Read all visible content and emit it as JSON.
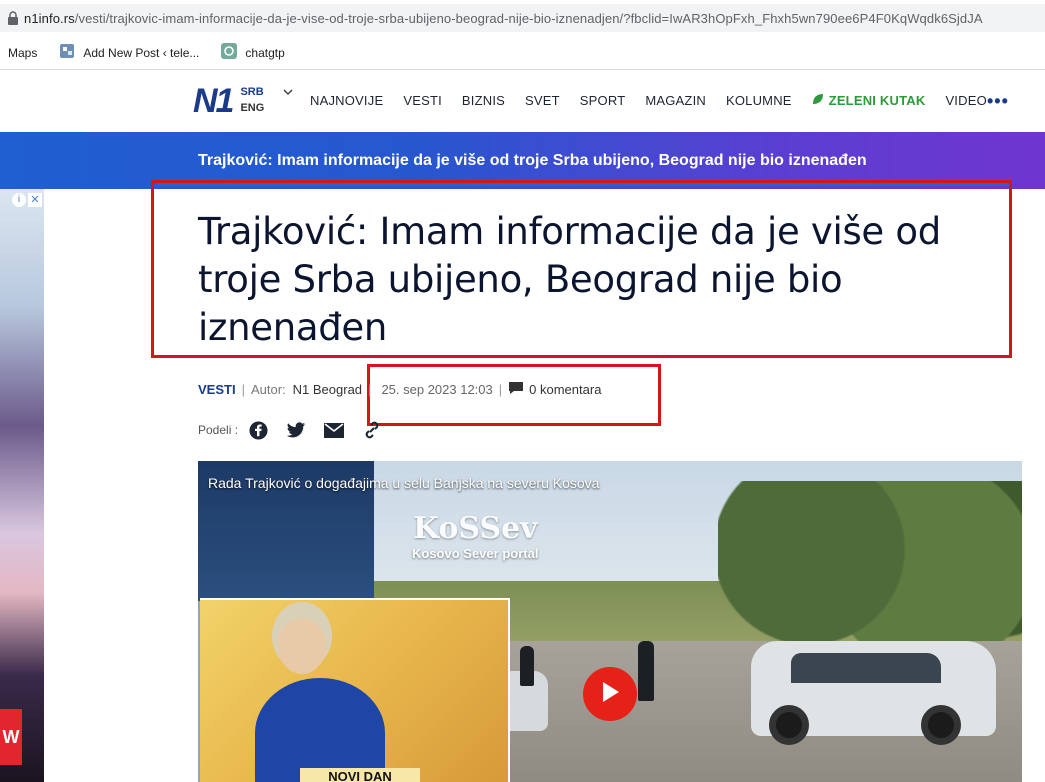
{
  "browser": {
    "url_host": "n1info.rs",
    "url_path": "/vesti/trajkovic-imam-informacije-da-je-vise-od-troje-srba-ubijeno-beograd-nije-bio-iznenadjen/?fbclid=IwAR3hOpFxh_Fhxh5wn790ee6P4F0KqWqdk6SjdJA",
    "bookmarks": [
      {
        "label": "Maps",
        "icon": "maps-icon"
      },
      {
        "label": "Add New Post ‹ tele...",
        "icon": "wordpress-icon"
      },
      {
        "label": "chatgtp",
        "icon": "openai-icon"
      }
    ]
  },
  "site": {
    "logo": "N1",
    "lang_primary": "SRB",
    "lang_secondary": "ENG",
    "nav": [
      "NAJNOVIJE",
      "VESTI",
      "BIZNIS",
      "SVET",
      "SPORT",
      "MAGAZIN",
      "KOLUMNE",
      "ZELENI KUTAK",
      "VIDEO"
    ],
    "more": "•••",
    "accent": "#1a3a8a",
    "green": "#2e9a3a"
  },
  "banner": {
    "text": "Trajković: Imam informacije da je više od troje Srba ubijeno, Beograd nije bio iznenađen"
  },
  "article": {
    "title": "Trajković: Imam informacije da je više od troje Srba ubijeno, Beograd nije bio iznenađen",
    "category": "VESTI",
    "author_label": "Autor:",
    "author": "N1 Beograd",
    "date": "25. sep 2023 12:03",
    "comments": "0 komentara",
    "share_label": "Podeli :"
  },
  "video": {
    "title": "Rada Trajković o događajima u selu Banjska na severu Kosova",
    "watermark": "KoSSev",
    "watermark_sub": "Kosovo Sever portal",
    "inset_caption": "NOVI DAN"
  },
  "ad": {
    "red_letter": "W"
  },
  "annotation_color": "#d4151d"
}
